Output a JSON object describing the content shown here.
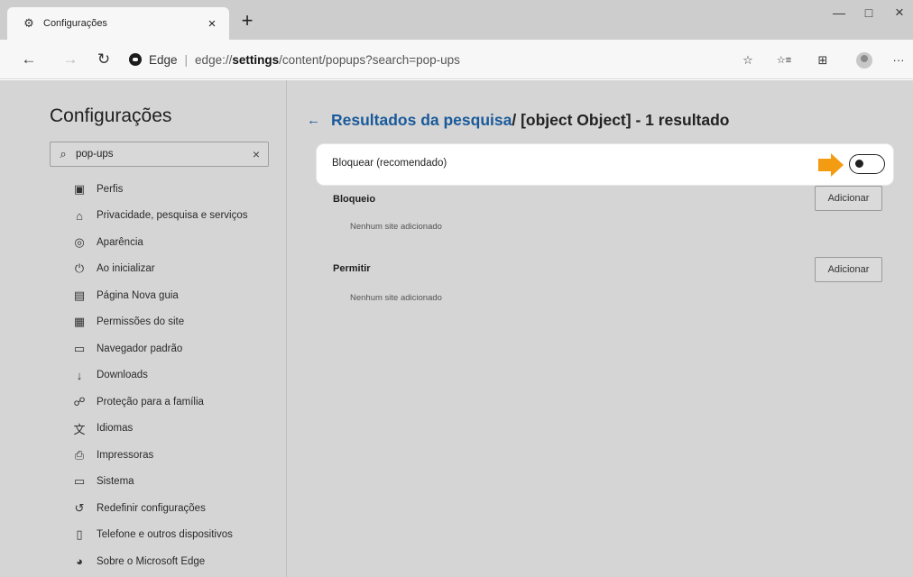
{
  "tab": {
    "icon": "gear-icon",
    "title": "Configurações",
    "close": "×"
  },
  "new_tab": "+",
  "window_controls": {
    "minimize": "—",
    "maximize": "□",
    "close": "×"
  },
  "nav": {
    "back": "←",
    "forward": "→",
    "refresh": "↻"
  },
  "address": {
    "site_name": "Edge",
    "separator": "|",
    "url_prefix": "edge://",
    "url_host": "settings",
    "url_path": "/content/popups?search=pop-ups"
  },
  "toolbar": {
    "favorite": "☆",
    "favorites_list": "☆≡",
    "collections": "⊞",
    "more": "···"
  },
  "sidebar": {
    "title": "Configurações",
    "search_value": "pop-ups",
    "clear": "×",
    "items": [
      {
        "icon": "profile-icon",
        "glyph": "▣",
        "label": "Perfis"
      },
      {
        "icon": "lock-icon",
        "glyph": "⌂",
        "label": "Privacidade, pesquisa e serviços"
      },
      {
        "icon": "palette-icon",
        "glyph": "◎",
        "label": "Aparência"
      },
      {
        "icon": "power-icon",
        "glyph": "⏻",
        "label": "Ao inicializar"
      },
      {
        "icon": "new-tab-page-icon",
        "glyph": "▤",
        "label": "Página Nova guia"
      },
      {
        "icon": "site-permissions-icon",
        "glyph": "▦",
        "label": "Permissões do site"
      },
      {
        "icon": "default-browser-icon",
        "glyph": "▭",
        "label": "Navegador padrão"
      },
      {
        "icon": "download-icon",
        "glyph": "↓",
        "label": "Downloads"
      },
      {
        "icon": "family-icon",
        "glyph": "☍",
        "label": "Proteção para a família"
      },
      {
        "icon": "languages-icon",
        "glyph": "文",
        "label": "Idiomas"
      },
      {
        "icon": "printer-icon",
        "glyph": "⎙",
        "label": "Impressoras"
      },
      {
        "icon": "system-icon",
        "glyph": "▭",
        "label": "Sistema"
      },
      {
        "icon": "reset-icon",
        "glyph": "↺",
        "label": "Redefinir configurações"
      },
      {
        "icon": "phone-icon",
        "glyph": "▯",
        "label": "Telefone e outros dispositivos"
      },
      {
        "icon": "edge-logo-icon",
        "glyph": "◕",
        "label": "Sobre o Microsoft Edge"
      }
    ]
  },
  "main": {
    "back": "←",
    "breadcrumb_link": "Resultados da pesquisa",
    "breadcrumb_rest": " / [object Object] - 1 resultado",
    "block_toggle_label": "Bloquear (recomendado)",
    "block_toggle_on": false,
    "block_section": {
      "title": "Bloqueio",
      "empty": "Nenhum site adicionado",
      "button": "Adicionar"
    },
    "allow_section": {
      "title": "Permitir",
      "empty": "Nenhum site adicionado",
      "button": "Adicionar"
    }
  },
  "colors": {
    "link": "#1a5a9a",
    "callout": "#f39c12",
    "dim_overlay": "#d5d5d5"
  }
}
